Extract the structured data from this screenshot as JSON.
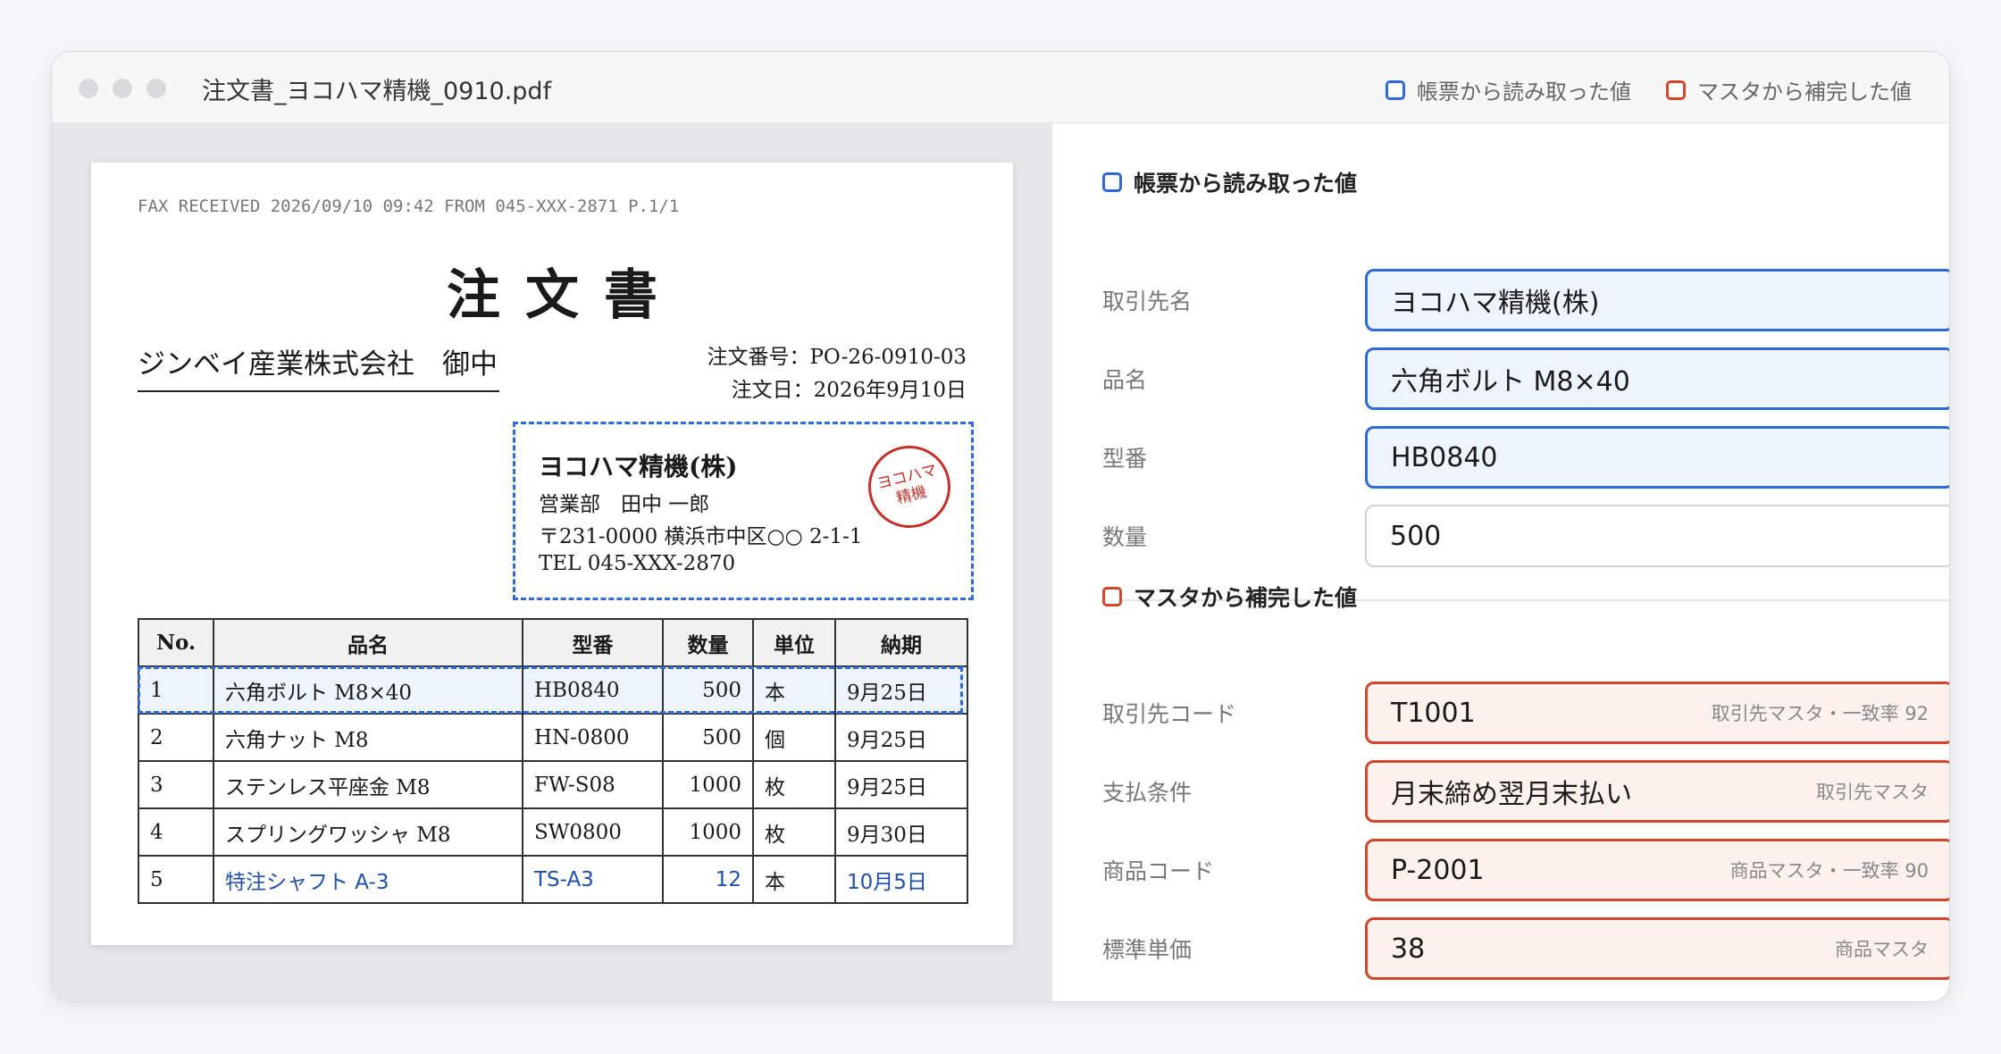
{
  "window": {
    "title": "注文書_ヨコハマ精機_0910.pdf"
  },
  "legend": {
    "read": {
      "label": "帳票から読み取った値",
      "color": "#2f6bd6"
    },
    "master": {
      "label": "マスタから補完した値",
      "color": "#d2472a"
    }
  },
  "document": {
    "fax_header": "FAX RECEIVED 2026/09/10 09:42 FROM 045-XXX-2871 P.1/1",
    "title": "注文書",
    "recipient": "ジンベイ産業株式会社　御中",
    "order_number": "注文番号：PO-26-0910-03",
    "order_date": "注文日：2026年9月10日",
    "sender": {
      "company": "ヨコハマ精機(株)",
      "department": "営業部　田中 一郎",
      "address": "〒231-0000 横浜市中区○○ 2-1-1",
      "tel": "TEL 045-XXX-2870",
      "stamp_line1": "ヨコハマ",
      "stamp_line2": "精機"
    },
    "table": {
      "headers": [
        "No.",
        "品名",
        "型番",
        "数量",
        "単位",
        "納期"
      ],
      "rows": [
        [
          "1",
          "六角ボルト M8×40",
          "HB0840",
          "500",
          "本",
          "9月25日"
        ],
        [
          "2",
          "六角ナット M8",
          "HN-0800",
          "500",
          "個",
          "9月25日"
        ],
        [
          "3",
          "ステンレス平座金 M8",
          "FW-S08",
          "1000",
          "枚",
          "9月25日"
        ],
        [
          "4",
          "スプリングワッシャ M8",
          "SW0800",
          "1000",
          "枚",
          "9月30日"
        ],
        [
          "5",
          "特注シャフト A-3",
          "TS-A3",
          "12",
          "本",
          "10月5日"
        ]
      ]
    }
  },
  "read_section": {
    "title": "帳票から読み取った値",
    "fields": [
      {
        "label": "取引先名",
        "value": "ヨコハマ精機(株)"
      },
      {
        "label": "品名",
        "value": "六角ボルト M8×40"
      },
      {
        "label": "型番",
        "value": "HB0840"
      },
      {
        "label": "数量",
        "value": "500"
      }
    ]
  },
  "master_section": {
    "title": "マスタから補完した値",
    "fields": [
      {
        "label": "取引先コード",
        "value": "T1001",
        "note": "取引先マスタ・一致率 92"
      },
      {
        "label": "支払条件",
        "value": "月末締め翌月末払い",
        "note": "取引先マスタ"
      },
      {
        "label": "商品コード",
        "value": "P-2001",
        "note": "商品マスタ・一致率 90"
      },
      {
        "label": "標準単価",
        "value": "38",
        "note": "商品マスタ"
      }
    ]
  }
}
